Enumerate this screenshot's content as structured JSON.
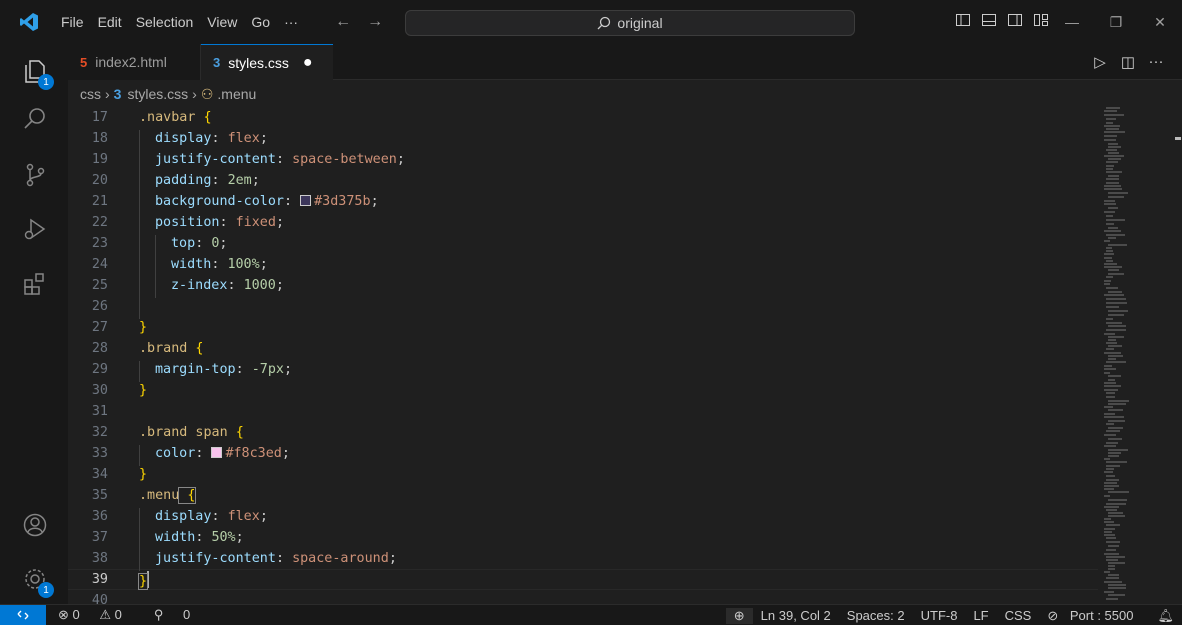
{
  "titlebar": {
    "menus": [
      "File",
      "Edit",
      "Selection",
      "View",
      "Go",
      "···"
    ],
    "search_text": "original"
  },
  "activity": {
    "explorer_badge": "1",
    "settings_badge": "1"
  },
  "tabs": [
    {
      "label": "index2.html",
      "icon": "html-file-icon",
      "icon_glyph": "5",
      "active": false
    },
    {
      "label": "styles.css",
      "icon": "css-file-icon",
      "icon_glyph": "3",
      "active": true,
      "modified_dot": "●"
    }
  ],
  "breadcrumb": {
    "folder": "css",
    "file": "styles.css",
    "symbol": ".menu"
  },
  "editor": {
    "line_numbers": [
      "17",
      "18",
      "19",
      "20",
      "21",
      "22",
      "23",
      "24",
      "25",
      "26",
      "27",
      "28",
      "29",
      "30",
      "31",
      "32",
      "33",
      "34",
      "35",
      "36",
      "37",
      "38",
      "39",
      "40"
    ],
    "color_swatches": {
      "navbar_bg": "#3d375b",
      "brand_span": "#f8c3ed"
    },
    "lines": [
      {
        "sel": ".navbar",
        "brace": " {"
      },
      {
        "prop": "display",
        "colon": ": ",
        "val": "flex",
        "semi": ";"
      },
      {
        "prop": "justify-content",
        "colon": ": ",
        "val": "space-between",
        "semi": ";"
      },
      {
        "prop": "padding",
        "colon": ": ",
        "num": "2em",
        "semi": ";"
      },
      {
        "prop": "background-color",
        "colon": ": ",
        "val": "#3d375b",
        "semi": ";"
      },
      {
        "prop": "position",
        "colon": ": ",
        "val": "fixed",
        "semi": ";"
      },
      {
        "prop": "top",
        "colon": ": ",
        "num": "0",
        "semi": ";"
      },
      {
        "prop": "width",
        "colon": ": ",
        "num": "100%",
        "semi": ";"
      },
      {
        "prop": "z-index",
        "colon": ": ",
        "num": "1000",
        "semi": ";"
      },
      {},
      {
        "brace": "}"
      },
      {
        "sel": ".brand",
        "brace": " {"
      },
      {
        "prop": "margin-top",
        "colon": ": ",
        "num": "-7px",
        "semi": ";"
      },
      {
        "brace": "}"
      },
      {},
      {
        "sel": ".brand span",
        "brace": " {"
      },
      {
        "prop": "color",
        "colon": ": ",
        "val": "#f8c3ed",
        "semi": ";"
      },
      {
        "brace": "}"
      },
      {
        "sel": ".menu",
        "brace": " {"
      },
      {
        "prop": "display",
        "colon": ": ",
        "val": "flex",
        "semi": ";"
      },
      {
        "prop": "width",
        "colon": ": ",
        "num": "50%",
        "semi": ";"
      },
      {
        "prop": "justify-content",
        "colon": ": ",
        "val": "space-around",
        "semi": ";"
      },
      {
        "brace": "}"
      },
      {}
    ]
  },
  "statusbar": {
    "errors": "0",
    "warnings": "0",
    "ports": "0",
    "position": "Ln 39, Col 2",
    "spaces": "Spaces: 2",
    "encoding": "UTF-8",
    "eol": "LF",
    "language": "CSS",
    "port": "Port : 5500"
  },
  "colors": {
    "accent": "#0078d4",
    "editor_bg": "#1f1f1f",
    "html_icon": "#e44d26",
    "css_icon": "#4a9fe0"
  }
}
